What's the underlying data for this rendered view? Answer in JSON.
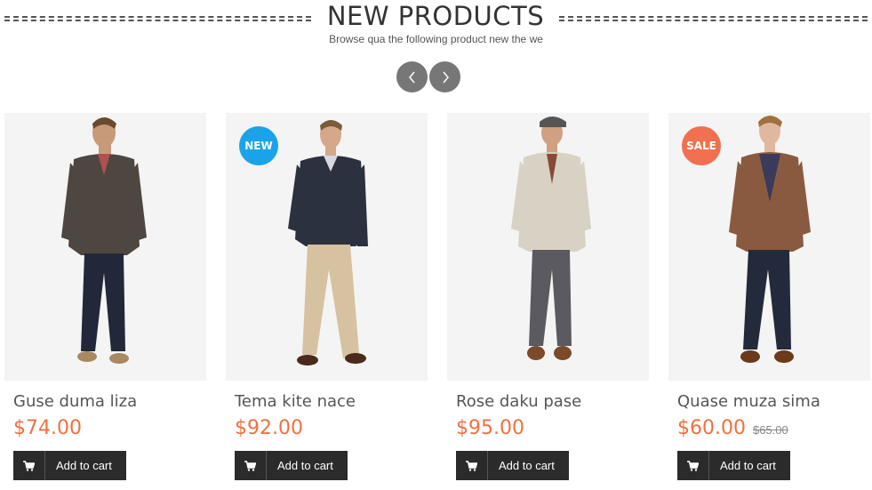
{
  "section": {
    "title": "NEW PRODUCTS",
    "subtitle": "Browse qua the following product new the we"
  },
  "carousel": {
    "prev_icon": "chevron-left-icon",
    "next_icon": "chevron-right-icon"
  },
  "colors": {
    "price": "#f07040",
    "badge_new": "#1aa3e8",
    "badge_sale": "#f07050",
    "button_bg": "#2b2b2b"
  },
  "products": [
    {
      "name": "Guse duma liza",
      "price": "$74.00",
      "old_price": "",
      "badge": "",
      "cart_label": "Add to cart"
    },
    {
      "name": "Tema kite nace",
      "price": "$92.00",
      "old_price": "",
      "badge": "NEW",
      "cart_label": "Add to cart"
    },
    {
      "name": "Rose daku pase",
      "price": "$95.00",
      "old_price": "",
      "badge": "",
      "cart_label": "Add to cart"
    },
    {
      "name": "Quase muza sima",
      "price": "$60.00",
      "old_price": "$65.00",
      "badge": "SALE",
      "cart_label": "Add to cart"
    }
  ]
}
